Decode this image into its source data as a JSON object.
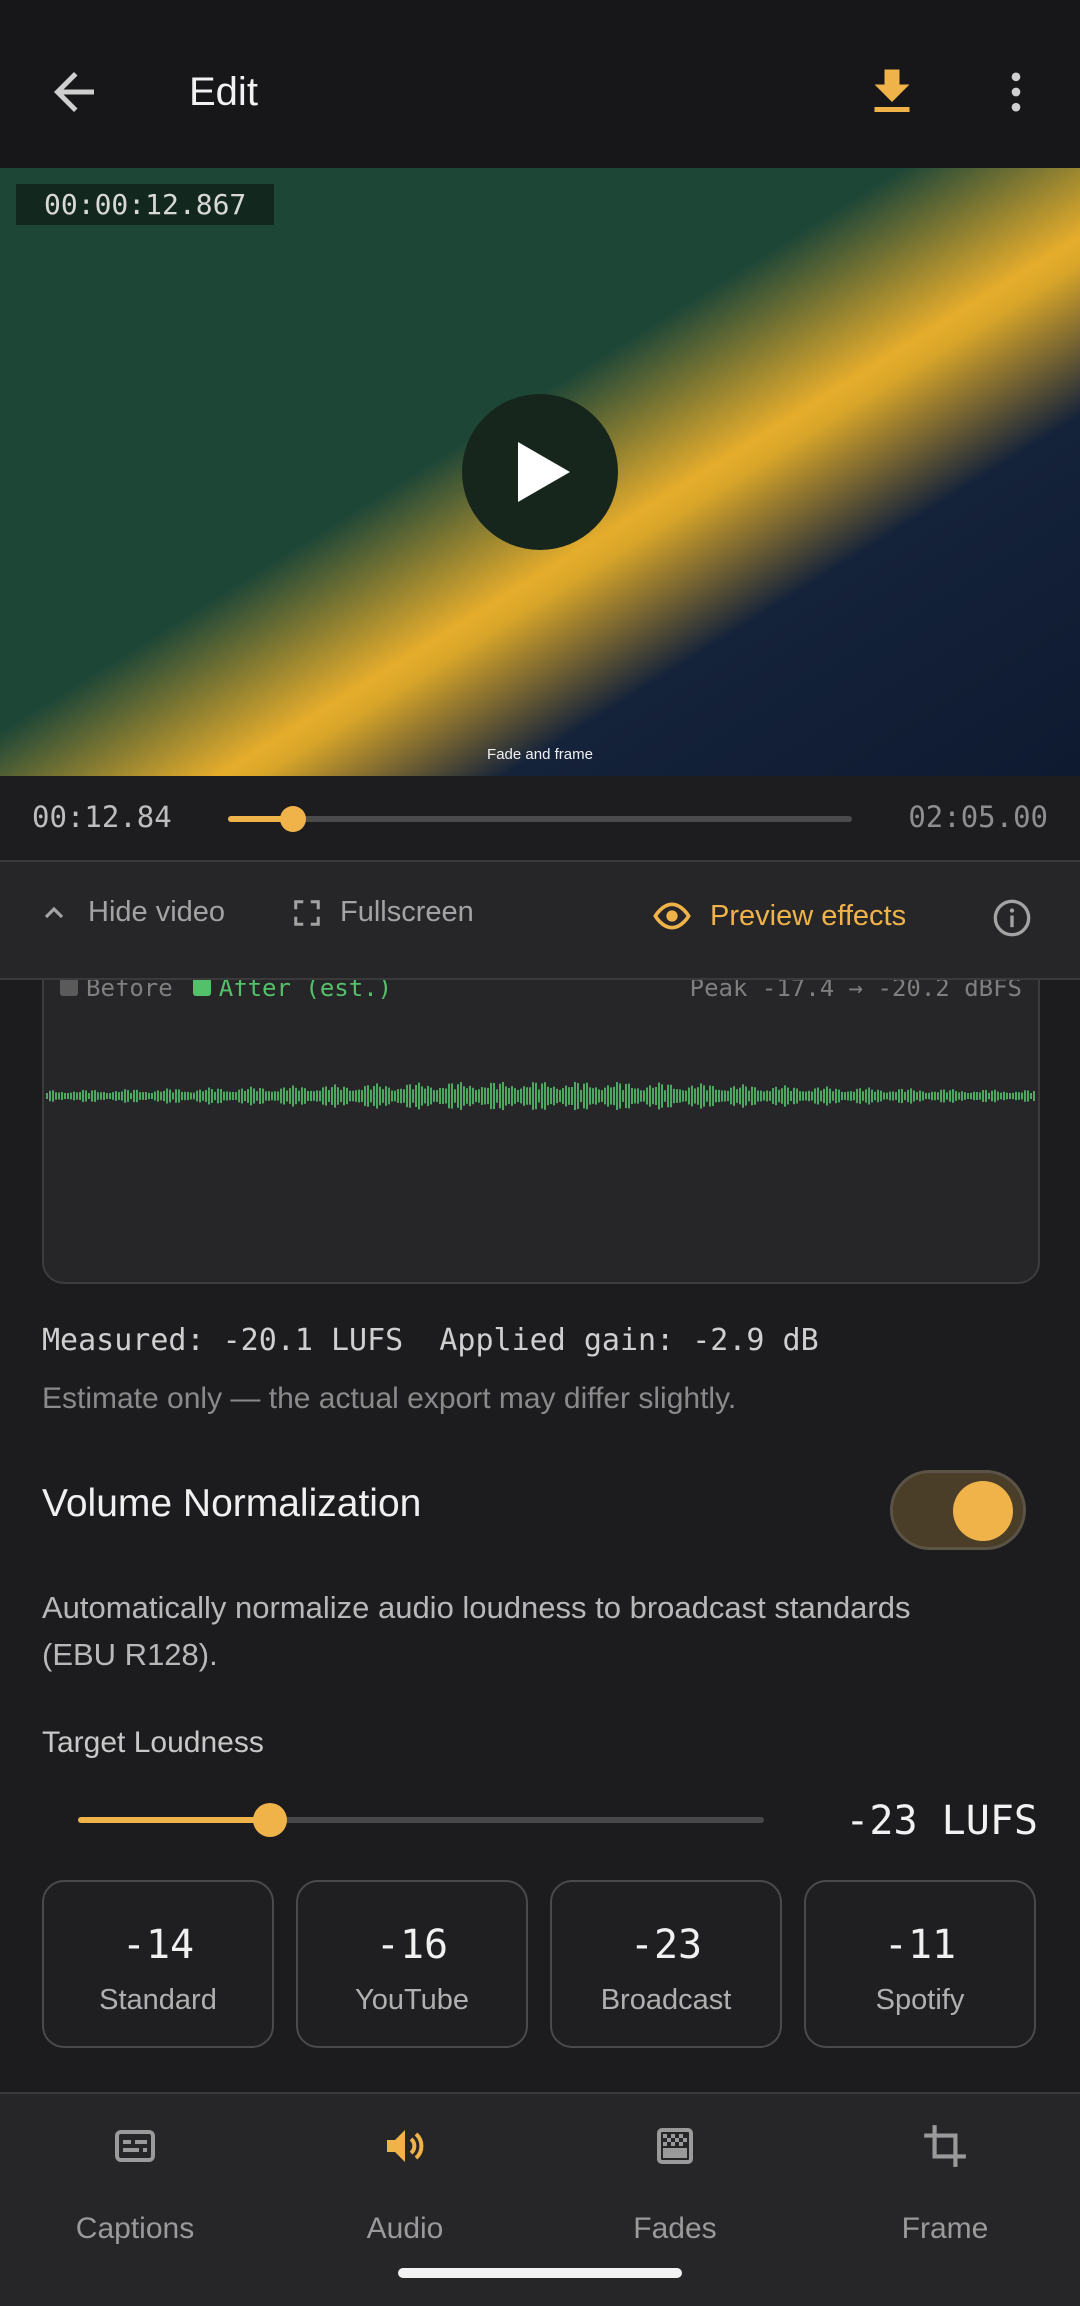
{
  "app_bar": {
    "title": "Edit",
    "back_icon": "arrow-left-icon",
    "download_icon": "download-icon",
    "menu_icon": "more-vert-icon",
    "accent": "#f0b34a"
  },
  "video": {
    "timecode": "00:00:12.867",
    "caption": "Fade and frame",
    "play_icon": "play-icon"
  },
  "scrubber": {
    "current": "00:12.84",
    "duration": "02:05.00",
    "progress": 0.104
  },
  "controls": {
    "hide_video": "Hide video",
    "fullscreen": "Fullscreen",
    "preview_effects": "Preview effects"
  },
  "waveform": {
    "legend_before": "Before",
    "legend_after": "After (est.)",
    "peak": "Peak -17.4 → -20.2 dBFS",
    "after_color": "#54c06a"
  },
  "stats": {
    "measured": "Measured: -20.1 LUFS  Applied gain: -2.9 dB",
    "note": "Estimate only — the actual export may differ slightly."
  },
  "normalization": {
    "label": "Volume Normalization",
    "enabled": true,
    "description": "Automatically normalize audio loudness to broadcast standards (EBU R128).",
    "target_label": "Target Loudness",
    "target_value": "-23 LUFS",
    "slider_fraction": 0.28
  },
  "presets": [
    {
      "value": "-14",
      "name": "Standard",
      "selected": false
    },
    {
      "value": "-16",
      "name": "YouTube",
      "selected": false
    },
    {
      "value": "-23",
      "name": "Broadcast",
      "selected": true
    },
    {
      "value": "-11",
      "name": "Spotify",
      "selected": false
    }
  ],
  "bottom_nav": [
    {
      "label": "Captions",
      "icon": "captions-icon",
      "active": false
    },
    {
      "label": "Audio",
      "icon": "speaker-icon",
      "active": true
    },
    {
      "label": "Fades",
      "icon": "fades-icon",
      "active": false
    },
    {
      "label": "Frame",
      "icon": "crop-icon",
      "active": false
    }
  ]
}
